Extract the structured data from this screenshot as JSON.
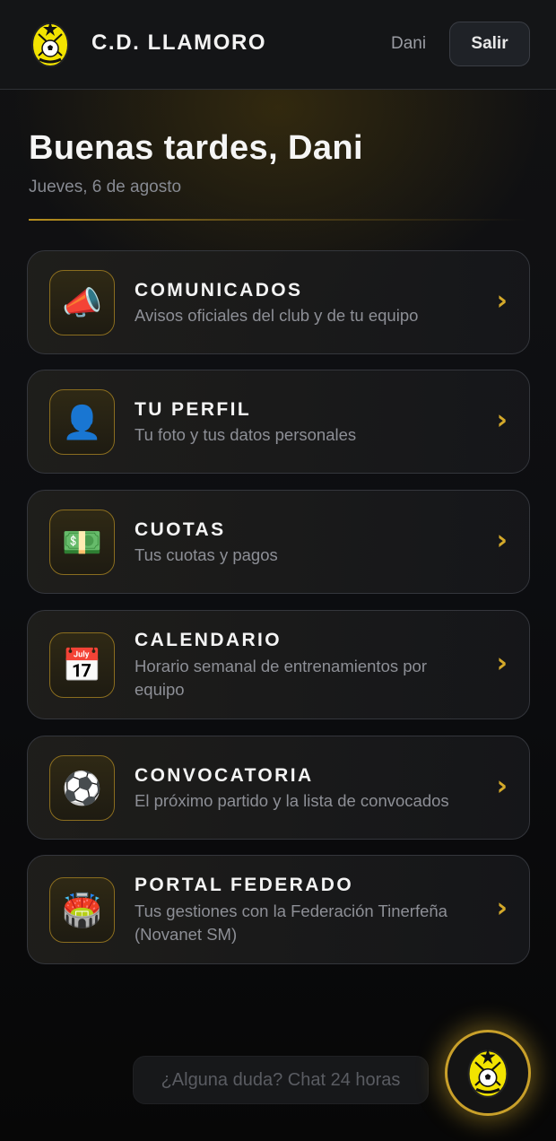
{
  "header": {
    "brand": "C.D. LLAMORO",
    "user_name": "Dani",
    "logout_label": "Salir"
  },
  "greeting": {
    "title": "Buenas tardes, Dani",
    "date": "Jueves, 6 de agosto"
  },
  "menu": [
    {
      "icon": "megaphone-icon",
      "glyph": "📣",
      "title": "COMUNICADOS",
      "desc": "Avisos oficiales del club y de tu equipo"
    },
    {
      "icon": "user-icon",
      "glyph": "👤",
      "title": "TU PERFIL",
      "desc": "Tu foto y tus datos personales"
    },
    {
      "icon": "money-icon",
      "glyph": "💵",
      "title": "CUOTAS",
      "desc": "Tus cuotas y pagos"
    },
    {
      "icon": "calendar-icon",
      "glyph": "📅",
      "title": "CALENDARIO",
      "desc": "Horario semanal de entrenamientos por equipo"
    },
    {
      "icon": "soccer-ball-icon",
      "glyph": "⚽",
      "title": "CONVOCATORIA",
      "desc": "El próximo partido y la lista de convocados"
    },
    {
      "icon": "stadium-icon",
      "glyph": "🏟️",
      "title": "PORTAL FEDERADO",
      "desc": "Tus gestiones con la Federación Tinerfeña (Novanet SM)"
    }
  ],
  "chat": {
    "pill_label": "¿Alguna duda? Chat 24 horas"
  },
  "colors": {
    "accent": "#d4a92a",
    "background": "#0d0e11"
  }
}
